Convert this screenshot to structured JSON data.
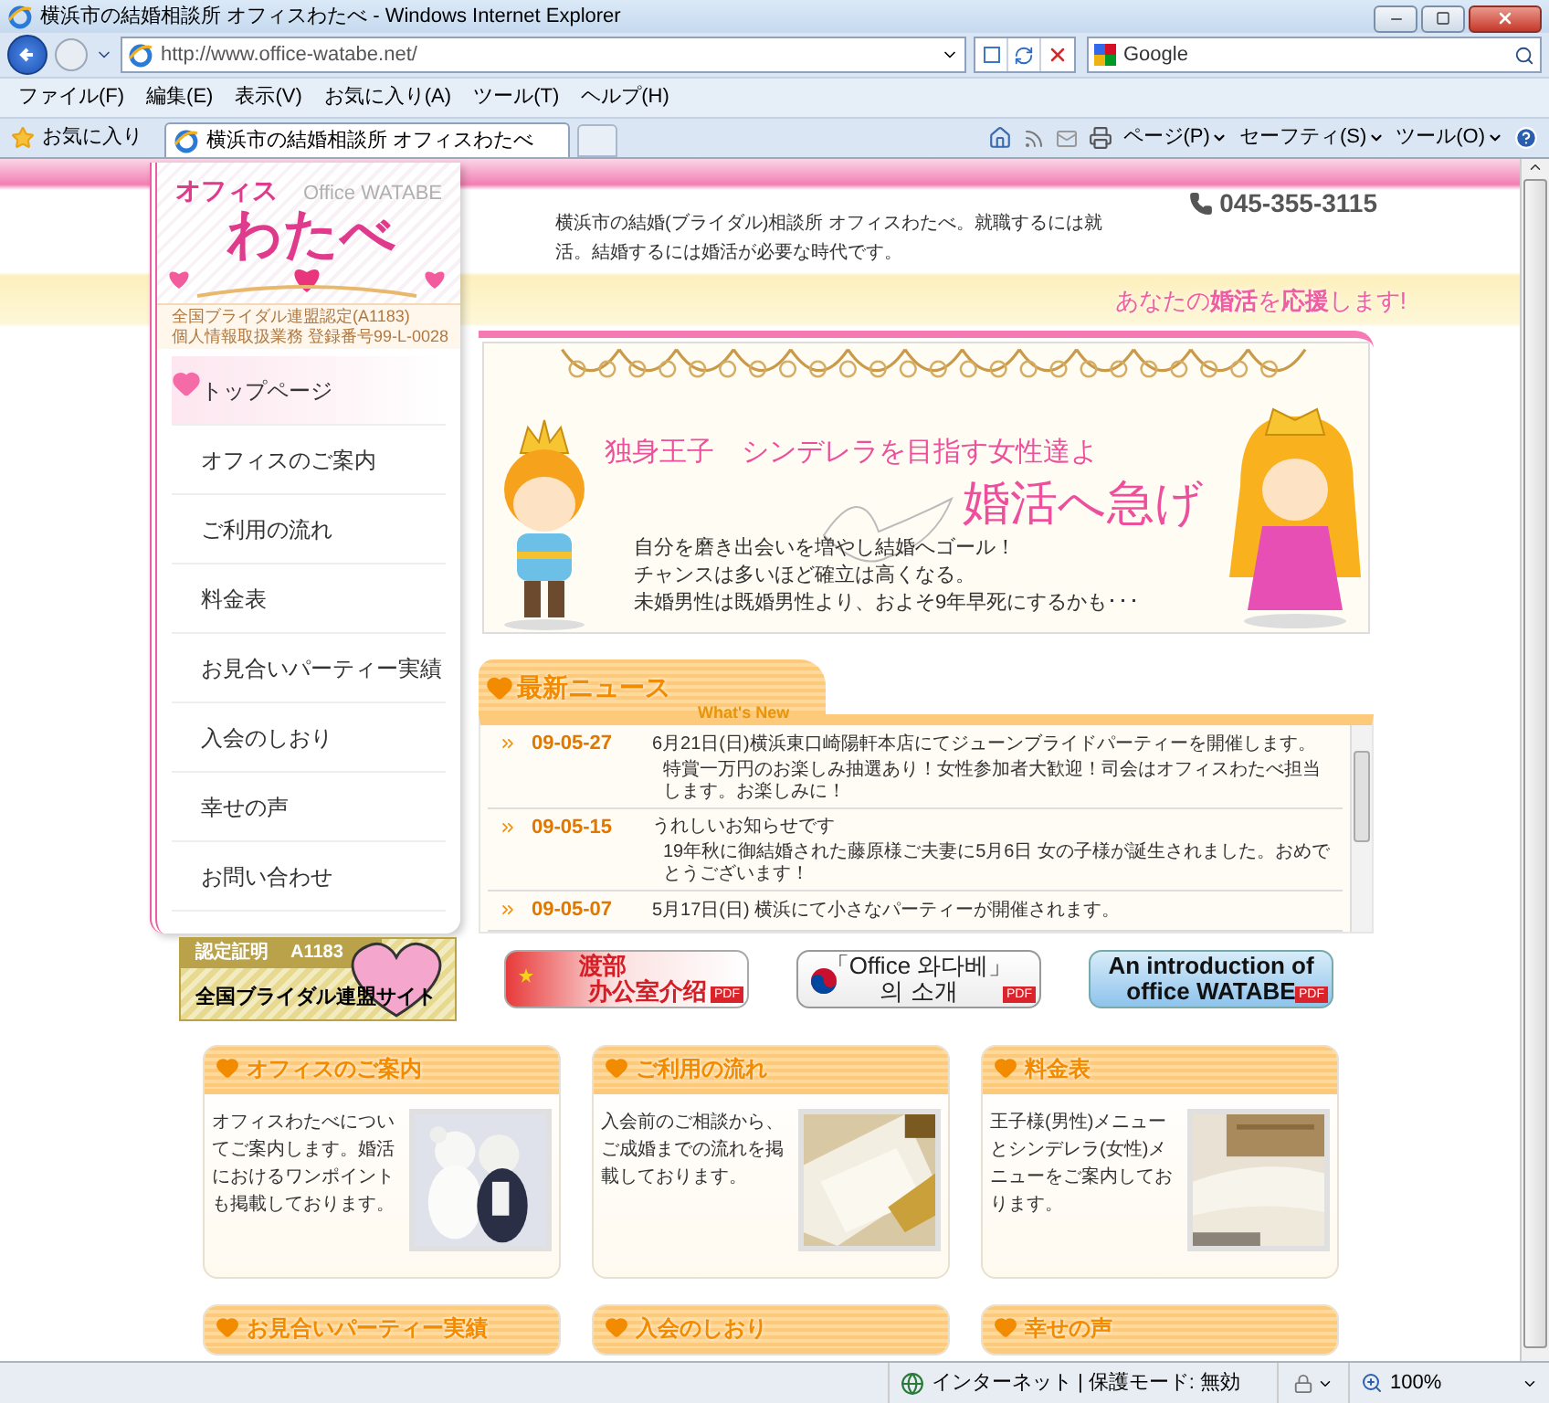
{
  "window": {
    "title": "横浜市の結婚相談所 オフィスわたべ - Windows Internet Explorer"
  },
  "address_bar": {
    "url": "http://www.office-watabe.net/"
  },
  "search": {
    "value": "Google"
  },
  "menu": [
    "ファイル(F)",
    "編集(E)",
    "表示(V)",
    "お気に入り(A)",
    "ツール(T)",
    "ヘルプ(H)"
  ],
  "favorites": "お気に入り",
  "tabs": [
    {
      "label": "横浜市の結婚相談所 オフィスわたべ",
      "selected": true
    }
  ],
  "toolbar": [
    "ページ(P)",
    "セーフティ(S)",
    "ツール(O)"
  ],
  "site": {
    "logo": {
      "top": "オフィス",
      "main": "わたべ",
      "sub": "Office WATABE"
    },
    "certification": [
      "全国ブライダル連盟認定(A1183)",
      "個人情報取扱業務 登録番号99-L-0028"
    ],
    "intro": "横浜市の結婚(ブライダル)相談所 オフィスわたべ。就職するには就活。結婚するには婚活が必要な時代です。",
    "phone": "045-355-3115",
    "tagline": "あなたの**婚活**を**応援**します!"
  },
  "nav": [
    {
      "label": "トップページ",
      "selected": true
    },
    {
      "label": "オフィスのご案内",
      "selected": false
    },
    {
      "label": "ご利用の流れ",
      "selected": false
    },
    {
      "label": "料金表",
      "selected": false
    },
    {
      "label": "お見合いパーティー実績",
      "selected": false
    },
    {
      "label": "入会のしおり",
      "selected": false
    },
    {
      "label": "幸せの声",
      "selected": false
    },
    {
      "label": "お問い合わせ",
      "selected": false
    }
  ],
  "hero": {
    "headline": "独身王子　シンデレラを目指す女性達よ",
    "slogan": "婚活へ急げ",
    "lines": [
      "自分を磨き出会いを増やし結婚へゴール！",
      "チャンスは多いほど確立は高くなる。",
      "未婚男性は既婚男性より、およそ9年早死にするかも･･･"
    ]
  },
  "news": {
    "title": "最新ニュース",
    "subtitle": "What's New",
    "items": [
      {
        "date": "09-05-27",
        "title": "6月21日(日)横浜東口崎陽軒本店にてジューンブライドパーティーを開催します。",
        "body": "特賞一万円のお楽しみ抽選あり！女性参加者大歓迎！司会はオフィスわたべ担当します。お楽しみに！"
      },
      {
        "date": "09-05-15",
        "title": "うれしいお知らせです",
        "body": "19年秋に御結婚された藤原様ご夫妻に5月6日 女の子様が誕生されました。おめでとうございます！"
      },
      {
        "date": "09-05-07",
        "title": "5月17日(日) 横浜にて小さなパーティーが開催されます。"
      }
    ]
  },
  "banners": [
    {
      "kind": "federation",
      "badge": "認定証明",
      "code": "A1183",
      "lines": [
        "全国ブライダル連盟サイト"
      ]
    },
    {
      "kind": "chinese",
      "lines": [
        "渡部",
        "办公室介绍"
      ],
      "pdf": "PDF"
    },
    {
      "kind": "korean",
      "lines": [
        "「Office 와다베」",
        "의 소개"
      ],
      "pdf": "PDF"
    },
    {
      "kind": "english",
      "lines": [
        "An introduction of",
        "office WATABE"
      ],
      "pdf": "PDF"
    }
  ],
  "cards": [
    {
      "title": "オフィスのご案内",
      "text": "オフィスわたべについてご案内します。婚活におけるワンポイントも掲載しております。"
    },
    {
      "title": "ご利用の流れ",
      "text": "入会前のご相談から、ご成婚までの流れを掲載しております。"
    },
    {
      "title": "料金表",
      "text": "王子様(男性)メニューとシンデレラ(女性)メニューをご案内しております。"
    },
    {
      "title": "お見合いパーティー実績"
    },
    {
      "title": "入会のしおり"
    },
    {
      "title": "幸せの声"
    }
  ],
  "status_bar": {
    "zone": "インターネット | 保護モード: 無効",
    "zoom": "100%"
  }
}
